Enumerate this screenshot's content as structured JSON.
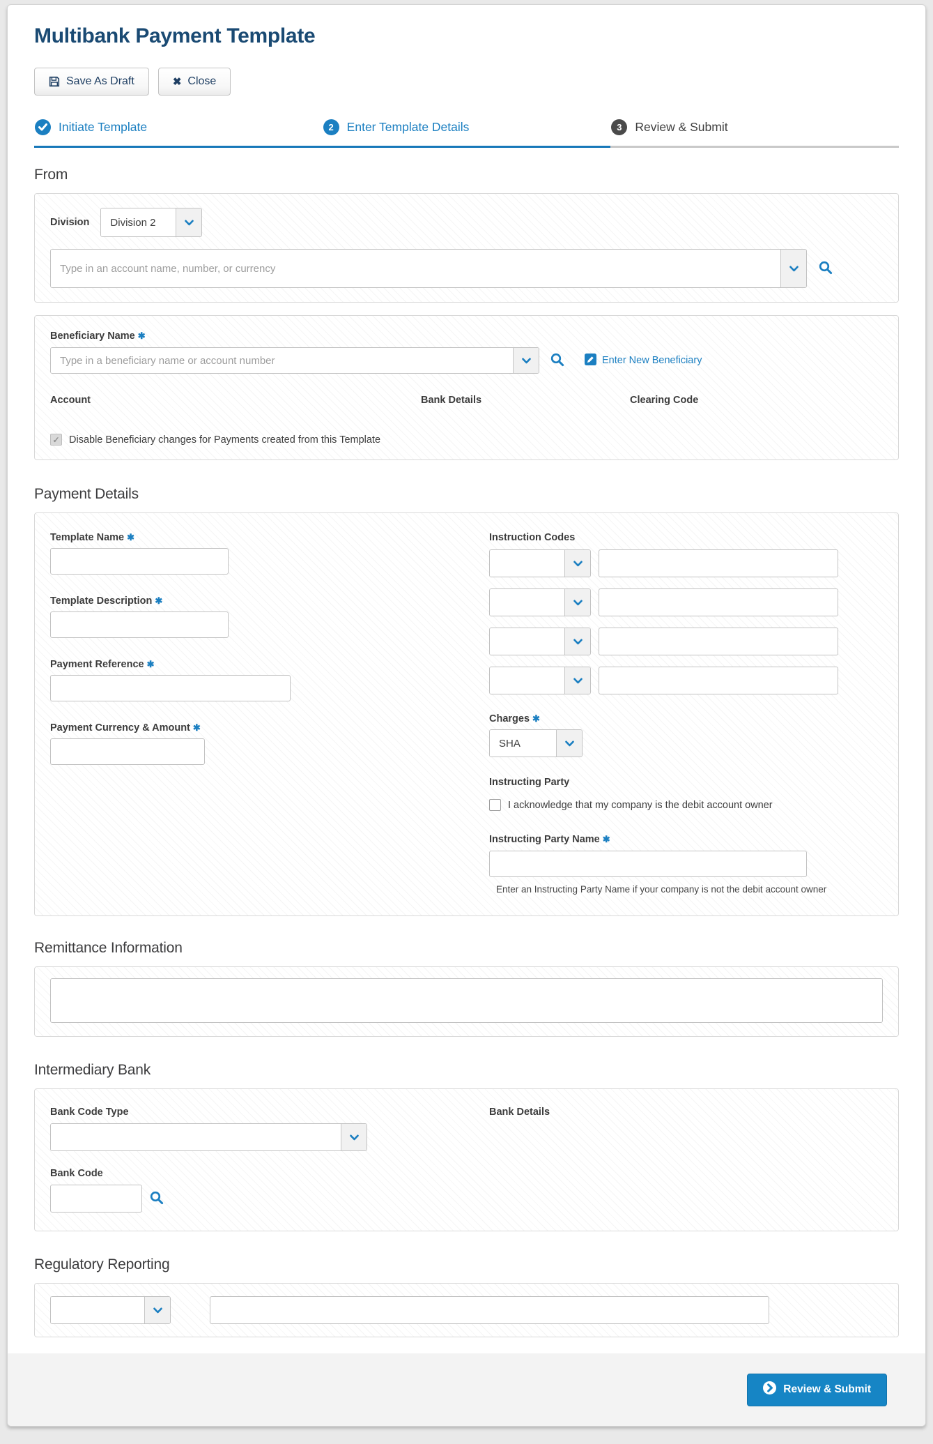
{
  "page": {
    "title": "Multibank Payment Template"
  },
  "toolbar": {
    "save_as_draft": "Save As Draft",
    "close": "Close"
  },
  "steps": [
    {
      "label": "Initiate Template",
      "state": "done"
    },
    {
      "label": "Enter Template Details",
      "state": "active",
      "number": "2"
    },
    {
      "label": "Review & Submit",
      "state": "todo",
      "number": "3"
    }
  ],
  "from_section": {
    "heading": "From",
    "division_label": "Division",
    "division_value": "Division 2",
    "account_placeholder": "Type in an account name, number, or currency"
  },
  "beneficiary": {
    "name_label": "Beneficiary Name",
    "input_placeholder": "Type in a beneficiary name or account number",
    "enter_new_link": "Enter New Beneficiary",
    "columns": {
      "account": "Account",
      "bank_details": "Bank Details",
      "clearing_code": "Clearing Code"
    },
    "disable_checkbox_label": "Disable Beneficiary changes for Payments created from this Template",
    "disable_checkbox_checked": true
  },
  "payment_details": {
    "heading": "Payment Details",
    "template_name_label": "Template Name",
    "template_description_label": "Template Description",
    "payment_reference_label": "Payment Reference",
    "payment_currency_label": "Payment Currency & Amount",
    "instruction_codes_label": "Instruction Codes",
    "charges_label": "Charges",
    "charges_value": "SHA",
    "instructing_party_label": "Instructing Party",
    "acknowledge_label": "I acknowledge that my company is the debit account owner",
    "acknowledge_checked": false,
    "instructing_party_name_label": "Instructing Party Name",
    "instructing_party_hint": "Enter an Instructing Party Name if your company is not the debit account owner"
  },
  "remittance": {
    "heading": "Remittance Information"
  },
  "intermediary_bank": {
    "heading": "Intermediary Bank",
    "bank_code_type_label": "Bank Code Type",
    "bank_details_label": "Bank Details",
    "bank_code_label": "Bank Code"
  },
  "regulatory": {
    "heading": "Regulatory Reporting"
  },
  "footer": {
    "review_submit": "Review & Submit"
  },
  "colors": {
    "accent": "#1b7fc1",
    "primary_button": "#1685c5",
    "title": "#1a4a73",
    "step_todo_circle": "#4a4a4a"
  }
}
